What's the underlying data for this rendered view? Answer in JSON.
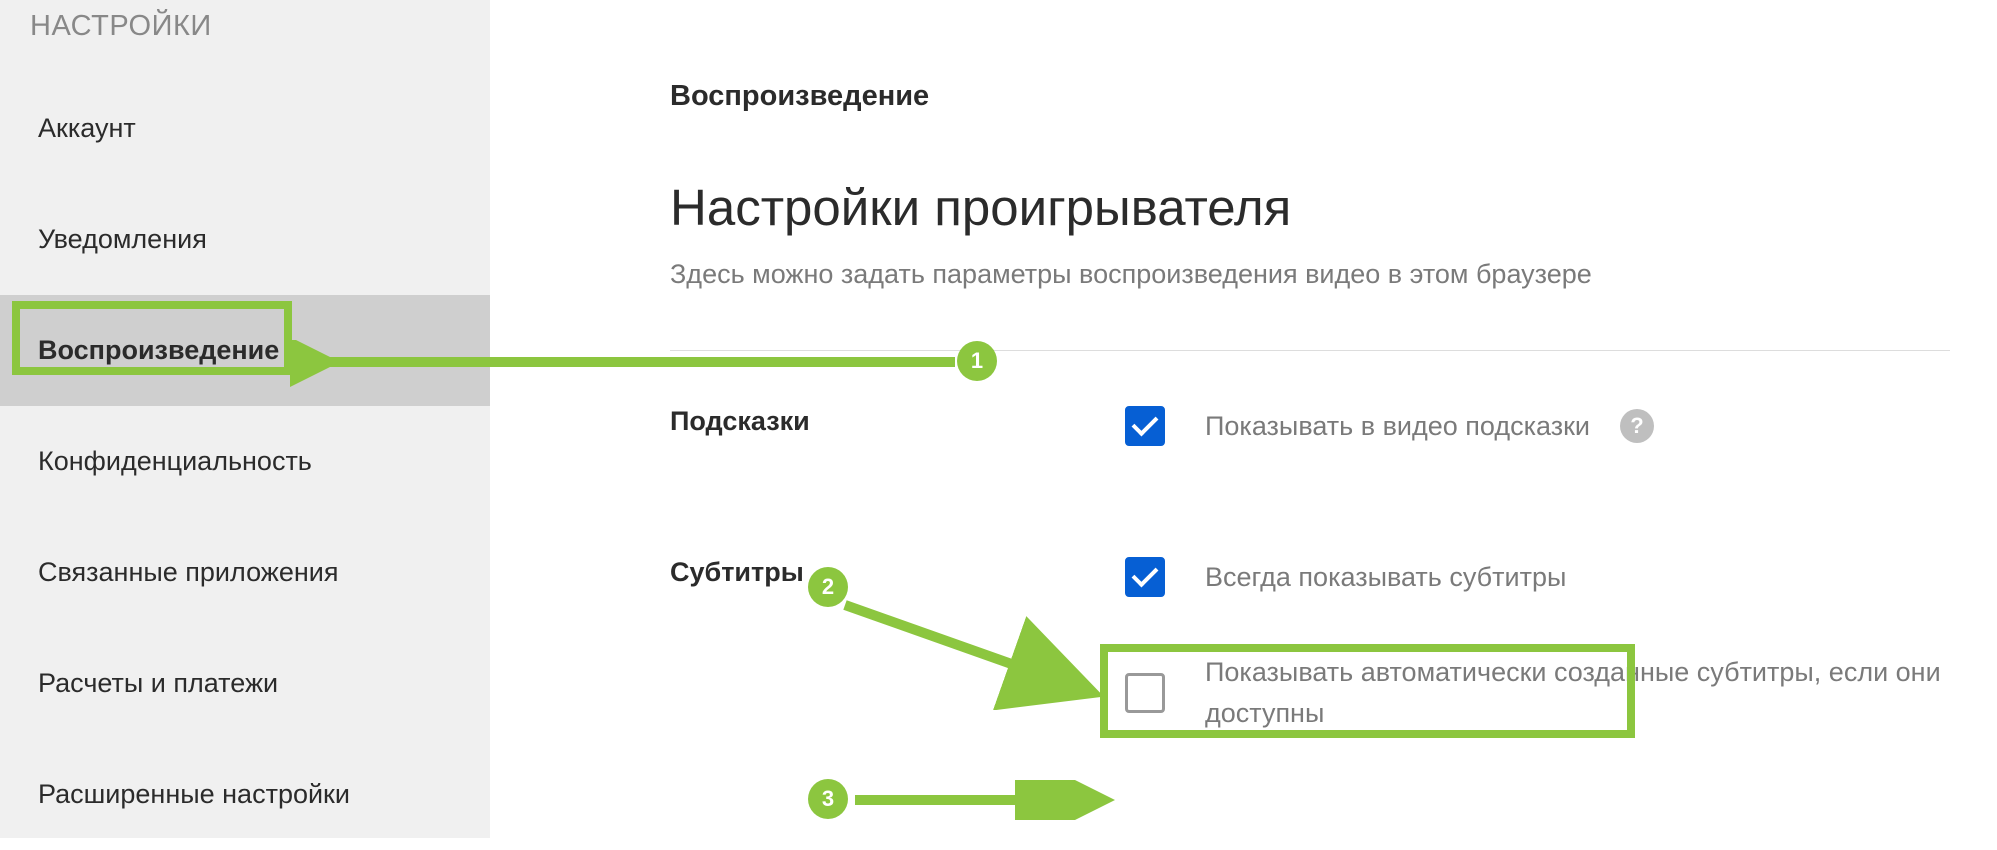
{
  "sidebar": {
    "title": "НАСТРОЙКИ",
    "items": [
      {
        "label": "Аккаунт"
      },
      {
        "label": "Уведомления"
      },
      {
        "label": "Воспроизведение"
      },
      {
        "label": "Конфиденциальность"
      },
      {
        "label": "Связанные приложения"
      },
      {
        "label": "Расчеты и платежи"
      },
      {
        "label": "Расширенные настройки"
      }
    ]
  },
  "main": {
    "page_title": "Воспроизведение",
    "section_heading": "Настройки проигрывателя",
    "section_subtext": "Здесь можно задать параметры воспроизведения видео в этом браузере",
    "hints": {
      "label": "Подсказки",
      "option1": "Показывать в видео подсказки"
    },
    "subtitles": {
      "label": "Субтитры",
      "option1": "Всегда показывать субтитры",
      "option2": "Показывать автоматически созданные субтитры, если они доступны"
    }
  },
  "annotations": {
    "step1": "1",
    "step2": "2",
    "step3": "3"
  }
}
